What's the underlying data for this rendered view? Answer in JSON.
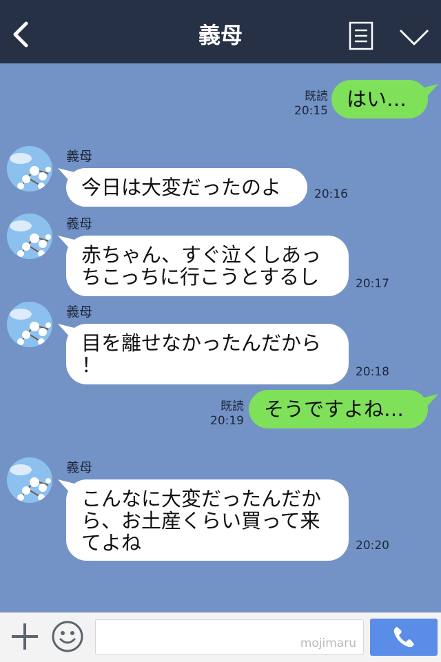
{
  "header": {
    "title": "義母"
  },
  "messages": [
    {
      "dir": "out",
      "text": "はい…",
      "read": "既読",
      "time": "20:15"
    },
    {
      "dir": "in",
      "sender": "義母",
      "text": "今日は大変だったのよ",
      "time": "20:16"
    },
    {
      "dir": "in",
      "sender": "義母",
      "text": "赤ちゃん、すぐ泣くしあっ\nちこっちに行こうとするし",
      "time": "20:17"
    },
    {
      "dir": "in",
      "sender": "義母",
      "text": "目を離せなかったんだから\n！",
      "time": "20:18"
    },
    {
      "dir": "out",
      "text": "そうですよね…",
      "read": "既読",
      "time": "20:19"
    },
    {
      "dir": "in",
      "sender": "義母",
      "text": "こんなに大変だったんだか\nら、お土産くらい買って来\nてよね",
      "time": "20:20"
    }
  ],
  "input": {
    "value": "",
    "watermark": "mojimaru"
  },
  "colors": {
    "header": "#263145",
    "background": "#7393c7",
    "outgoing_bubble": "#7fe05a",
    "incoming_bubble": "#ffffff",
    "call_button": "#5a8de8"
  },
  "icons": {
    "back": "chevron-left-icon",
    "notes": "notes-icon",
    "menu": "chevron-down-icon",
    "plus": "plus-icon",
    "emoji": "smiley-icon",
    "call": "phone-icon"
  }
}
